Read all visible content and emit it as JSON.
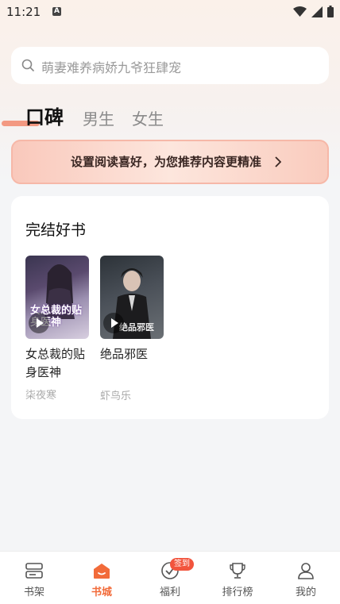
{
  "status_bar": {
    "time": "11:21",
    "notification_icon": "A"
  },
  "search": {
    "placeholder": "萌妻难养病娇九爷狂肆宠"
  },
  "tabs": [
    {
      "label": "口碑",
      "active": true
    },
    {
      "label": "男生",
      "active": false
    },
    {
      "label": "女生",
      "active": false
    }
  ],
  "banner": {
    "text": "设置阅读喜好，为您推荐内容更精准"
  },
  "section": {
    "title": "完结好书",
    "books": [
      {
        "title": "女总裁的贴身医神",
        "author": "柒夜寒",
        "cover_text": "女总裁的贴身医神"
      },
      {
        "title": "绝品邪医",
        "author": "虾鸟乐",
        "cover_text": "绝品邪医"
      }
    ]
  },
  "bottom_nav": [
    {
      "label": "书架",
      "icon": "bookshelf-icon",
      "active": false
    },
    {
      "label": "书城",
      "icon": "bookstore-icon",
      "active": true
    },
    {
      "label": "福利",
      "icon": "gift-icon",
      "active": false,
      "badge": "签到"
    },
    {
      "label": "排行榜",
      "icon": "trophy-icon",
      "active": false
    },
    {
      "label": "我的",
      "icon": "profile-icon",
      "active": false
    }
  ],
  "colors": {
    "accent": "#f26b3a",
    "badge": "#f2543d",
    "banner": "#fbd6cb"
  }
}
